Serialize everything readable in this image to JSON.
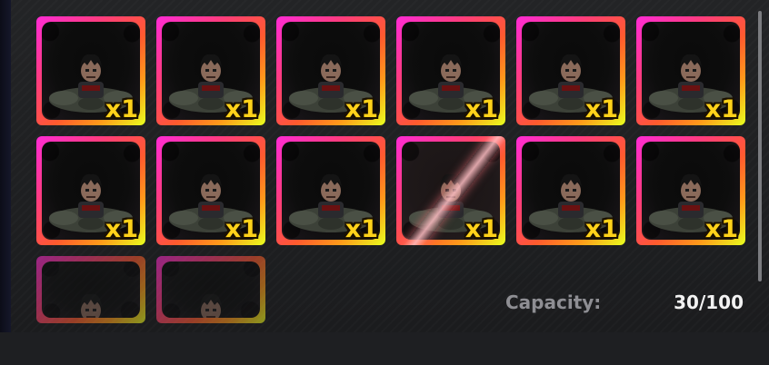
{
  "inventory": {
    "slots": [
      {
        "quantity": "x1",
        "state": "normal"
      },
      {
        "quantity": "x1",
        "state": "normal"
      },
      {
        "quantity": "x1",
        "state": "normal"
      },
      {
        "quantity": "x1",
        "state": "normal"
      },
      {
        "quantity": "x1",
        "state": "normal"
      },
      {
        "quantity": "x1",
        "state": "normal"
      },
      {
        "quantity": "x1",
        "state": "normal"
      },
      {
        "quantity": "x1",
        "state": "normal"
      },
      {
        "quantity": "x1",
        "state": "normal"
      },
      {
        "quantity": "x1",
        "state": "selected"
      },
      {
        "quantity": "x1",
        "state": "normal"
      },
      {
        "quantity": "x1",
        "state": "normal"
      },
      {
        "quantity": "",
        "state": "faded"
      },
      {
        "quantity": "",
        "state": "faded"
      }
    ],
    "capacity_label": "Capacity:",
    "capacity_value": "30/100"
  },
  "colors": {
    "rarity_gradient": [
      "#ff2bd6",
      "#ff5a2e",
      "#e8ff1e"
    ],
    "quantity_text": "#ffd21a",
    "capacity_label": "#8e8e93",
    "capacity_value": "#f2f2f2"
  }
}
